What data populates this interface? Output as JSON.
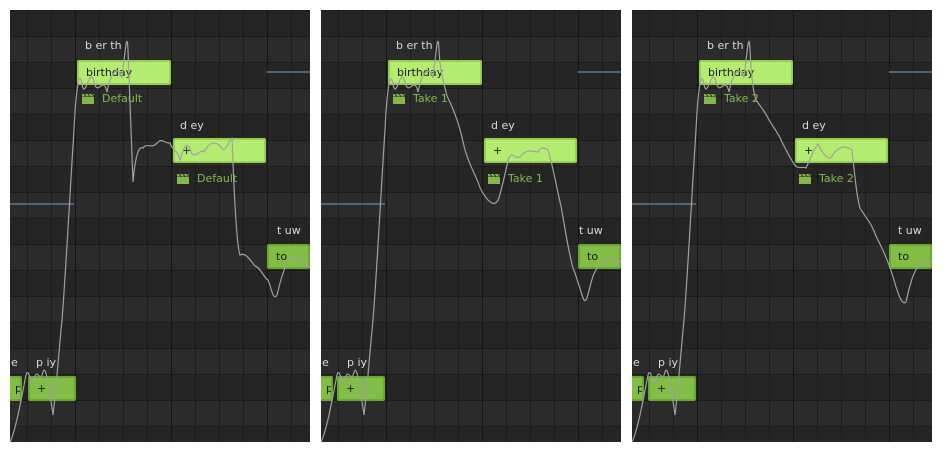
{
  "panels": [
    {
      "id": "default",
      "phonemes": [
        "b er th",
        "d ey",
        "t uw",
        "e",
        "p iy"
      ],
      "notes": [
        "birthday",
        "+",
        "to",
        "py",
        "+"
      ],
      "takes": [
        "Default",
        "Default"
      ]
    },
    {
      "id": "take1",
      "phonemes": [
        "b er th",
        "d ey",
        "t uw",
        "e",
        "p iy"
      ],
      "notes": [
        "birthday",
        "+",
        "to",
        "py",
        "+"
      ],
      "takes": [
        "Take 1",
        "Take 1"
      ]
    },
    {
      "id": "take2",
      "phonemes": [
        "b er th",
        "d ey",
        "t uw",
        "e",
        "p iy"
      ],
      "notes": [
        "birthday",
        "+",
        "to",
        "py",
        "+"
      ],
      "takes": [
        "Take 2",
        "Take 2"
      ]
    }
  ],
  "colors": {
    "background": "#2b2b2b",
    "row_alt": "#252525",
    "grid_line": "#1b1b1b",
    "note_fill": "#b3ec70",
    "note_fill_dark": "#82bd45",
    "take_text": "#84b84a",
    "pitch_line": "#a0a0a0",
    "reference_line": "#4f6478"
  },
  "icons": {
    "take_badge": "clapperboard-icon"
  }
}
